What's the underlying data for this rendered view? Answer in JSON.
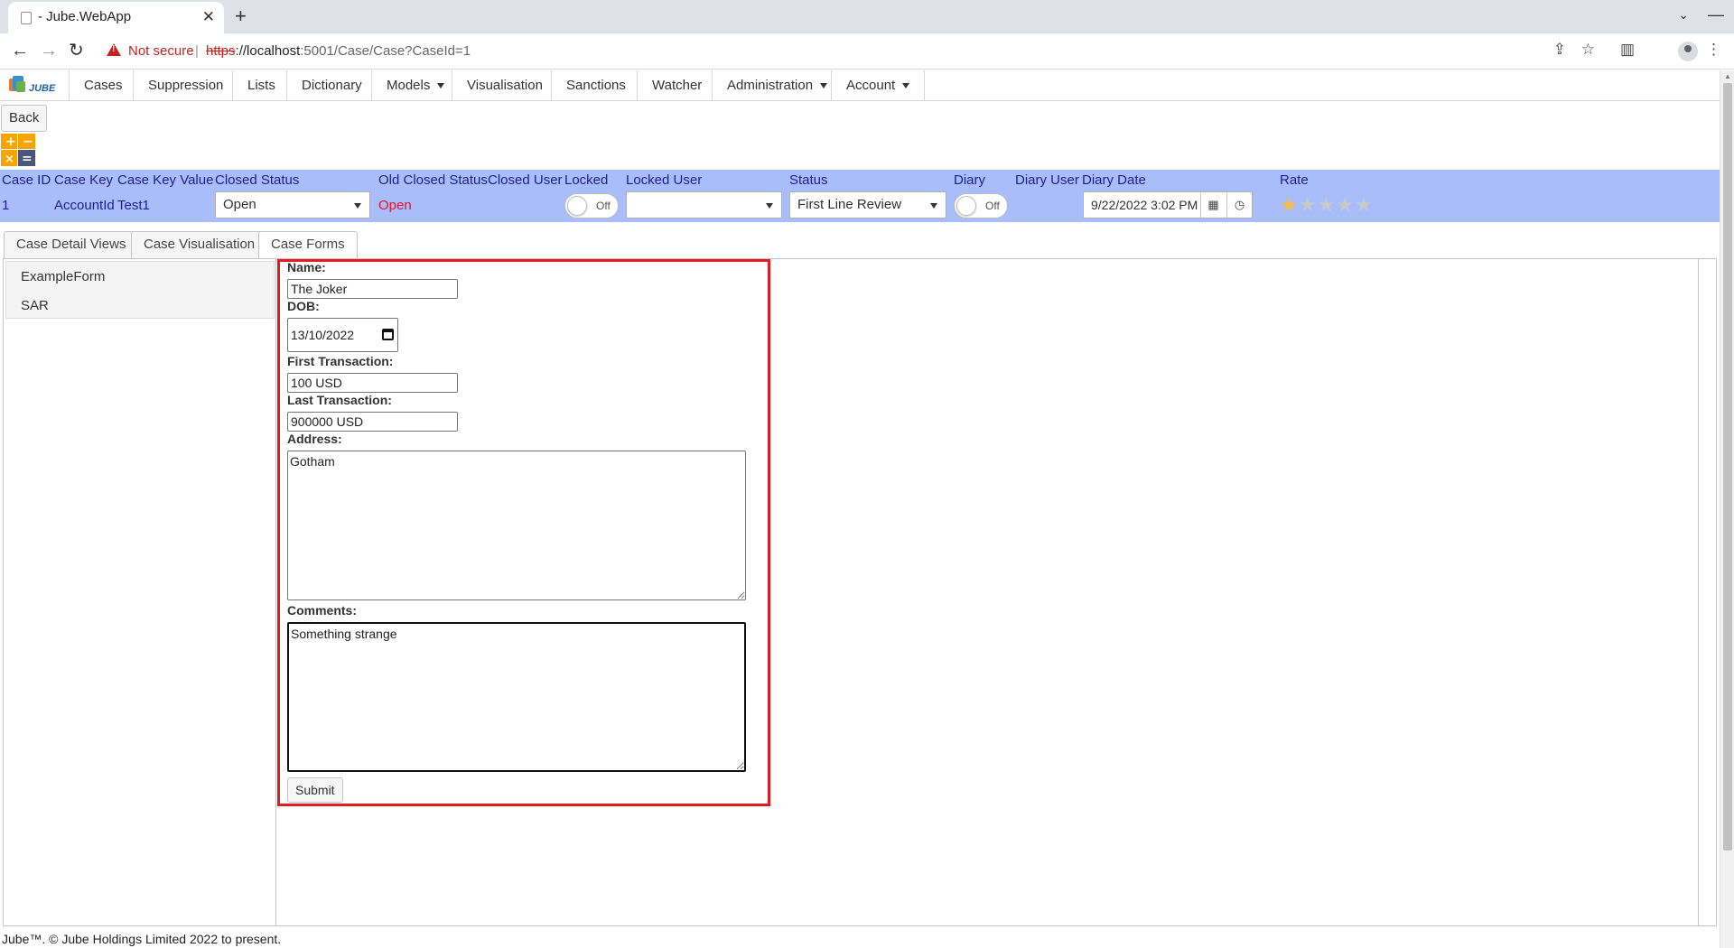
{
  "browser": {
    "tab_title": "- Jube.WebApp",
    "security_label": "Not secure",
    "url_scheme": "https",
    "url_host": "://localhost",
    "url_path": ":5001/Case/Case?CaseId=1"
  },
  "menu": {
    "items": [
      "Cases",
      "Suppression",
      "Lists",
      "Dictionary",
      "Models",
      "Visualisation",
      "Sanctions",
      "Watcher",
      "Administration",
      "Account"
    ]
  },
  "page": {
    "back_label": "Back"
  },
  "case": {
    "headers": {
      "case_id": "Case ID",
      "case_key": "Case Key",
      "case_key_value": "Case Key Value",
      "closed_status": "Closed Status",
      "old_closed_status": "Old Closed Status",
      "closed_user": "Closed User",
      "locked": "Locked",
      "locked_user": "Locked User",
      "status": "Status",
      "diary": "Diary",
      "diary_user": "Diary User",
      "diary_date": "Diary Date",
      "rate": "Rate"
    },
    "values": {
      "case_id": "1",
      "case_key": "AccountId",
      "case_key_value": "Test1",
      "closed_status": "Open",
      "old_closed_status": "Open",
      "locked": "Off",
      "locked_user": "",
      "status": "First Line Review",
      "diary": "Off",
      "diary_date": "9/22/2022 3:02 PM",
      "rating": 1,
      "rating_max": 5
    },
    "colors": {
      "header_bar": "#a9bdfb",
      "header_text": "#1d1d8f",
      "old_status": "#e8102c",
      "star_on": "#f3bd4c"
    }
  },
  "tabs": [
    "Case Detail Views",
    "Case Visualisation",
    "Case Forms"
  ],
  "active_tab": "Case Forms",
  "forms_list": [
    "ExampleForm",
    "SAR"
  ],
  "form": {
    "name_label": "Name:",
    "name_value": "The Joker",
    "dob_label": "DOB:",
    "dob_value": "13/10/2022",
    "first_txn_label": "First Transaction:",
    "first_txn_value": "100 USD",
    "last_txn_label": "Last Transaction:",
    "last_txn_value": "900000 USD",
    "address_label": "Address:",
    "address_value": "Gotham",
    "comments_label": "Comments:",
    "comments_value": "Something strange",
    "submit_label": "Submit"
  },
  "footer": "Jube™. © Jube Holdings Limited 2022 to present."
}
